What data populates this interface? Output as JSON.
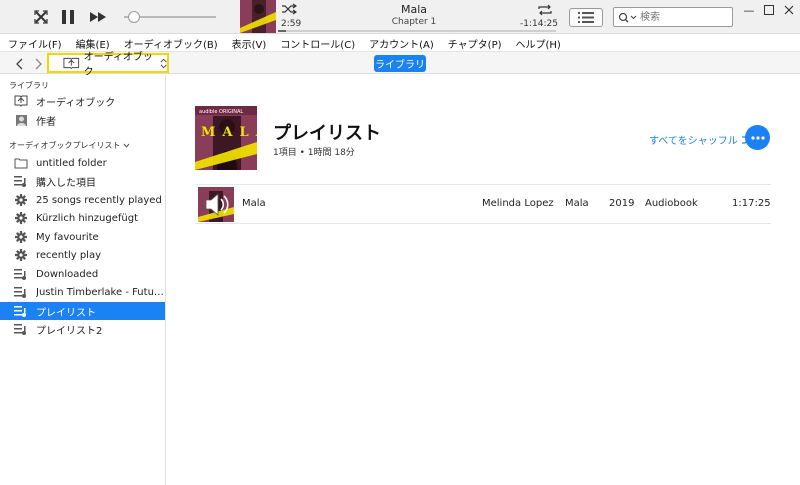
{
  "player": {
    "now_playing_title": "Mala",
    "now_playing_subtitle": "Chapter 1",
    "elapsed": "2:59",
    "remaining": "-1:14:25",
    "progress_fraction": 0.03,
    "volume_fraction": 0.05,
    "search_placeholder": "検索"
  },
  "menu": [
    "ファイル(F)",
    "編集(E)",
    "オーディオブック(B)",
    "表示(V)",
    "コントロール(C)",
    "アカウント(A)",
    "チャプタ(P)",
    "ヘルプ(H)"
  ],
  "nav": {
    "media_kind": "オーディオブック",
    "library_button": "ライブラリ"
  },
  "sidebar": {
    "library_header": "ライブラリ",
    "library_items": [
      {
        "label": "オーディオブック",
        "icon": "audiobook-icon"
      },
      {
        "label": "作者",
        "icon": "author-icon"
      }
    ],
    "playlists_header": "オーディオブックプレイリスト",
    "playlists": [
      {
        "label": "untitled folder",
        "icon": "folder-icon"
      },
      {
        "label": "購入した項目",
        "icon": "playlist-icon"
      },
      {
        "label": "25 songs recently played",
        "icon": "smart-playlist-icon"
      },
      {
        "label": "Kürzlich hinzugefügt",
        "icon": "smart-playlist-icon"
      },
      {
        "label": "My  favourite",
        "icon": "smart-playlist-icon"
      },
      {
        "label": "recently play",
        "icon": "smart-playlist-icon"
      },
      {
        "label": "Downloaded",
        "icon": "playlist-icon"
      },
      {
        "label": "Justin Timberlake - Futur...",
        "icon": "playlist-icon"
      },
      {
        "label": "プレイリスト",
        "icon": "playlist-icon",
        "selected": true
      },
      {
        "label": "プレイリスト2",
        "icon": "playlist-icon"
      }
    ]
  },
  "main": {
    "title": "プレイリスト",
    "meta": "1項目 • 1時間 18分",
    "shuffle_all": "すべてをシャッフル",
    "album_badge": "audible ORIGINAL",
    "album_letters": "MALA",
    "tracks": [
      {
        "name": "Mala",
        "artist": "Melinda Lopez",
        "album": "Mala",
        "year": "2019",
        "genre": "Audiobook",
        "time": "1:17:25"
      }
    ]
  },
  "colors": {
    "accent": "#1a82f3",
    "highlight_border": "#f5d800",
    "album_bg": "#8a3d58",
    "album_yellow": "#f2e300"
  }
}
